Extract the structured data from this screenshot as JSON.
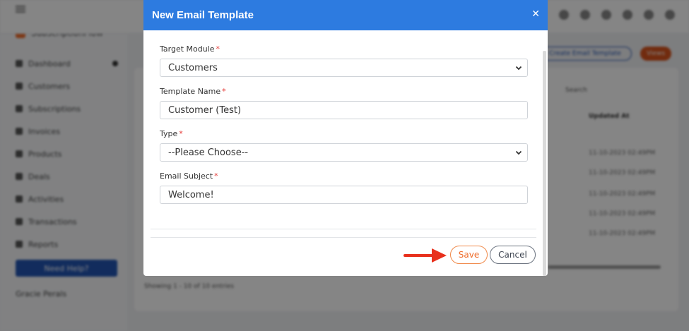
{
  "background": {
    "brand": "SubscriptionFlow",
    "nav_items": [
      "Dashboard",
      "Customers",
      "Subscriptions",
      "Invoices",
      "Products",
      "Deals",
      "Activities",
      "Transactions",
      "Reports"
    ],
    "help_button": "Need Help?",
    "user_name": "Gracie Perals",
    "create_button": "Create Email Template",
    "orange_button": "Views",
    "search_label": "Search",
    "column_header": "Updated At",
    "row_values": [
      "11-10-2023 02:49PM",
      "11-10-2023 02:49PM",
      "11-10-2023 02:49PM",
      "11-10-2023 02:49PM",
      "11-10-2023 02:49PM"
    ],
    "footer_text": "Showing 1 - 10 of 10 entries"
  },
  "modal": {
    "title": "New Email Template",
    "close_icon": "close-icon",
    "fields": {
      "target_module": {
        "label": "Target Module",
        "value": "Customers"
      },
      "template_name": {
        "label": "Template Name",
        "value": "Customer (Test)"
      },
      "type": {
        "label": "Type",
        "value": "--Please Choose--"
      },
      "email_subject": {
        "label": "Email Subject",
        "value": "Welcome!"
      }
    },
    "required_marker": "*",
    "save_label": "Save",
    "cancel_label": "Cancel"
  },
  "colors": {
    "header_blue": "#2d7be0",
    "accent_orange": "#ef6c2a",
    "arrow_red": "#e8301c",
    "required_red": "#e53935"
  }
}
